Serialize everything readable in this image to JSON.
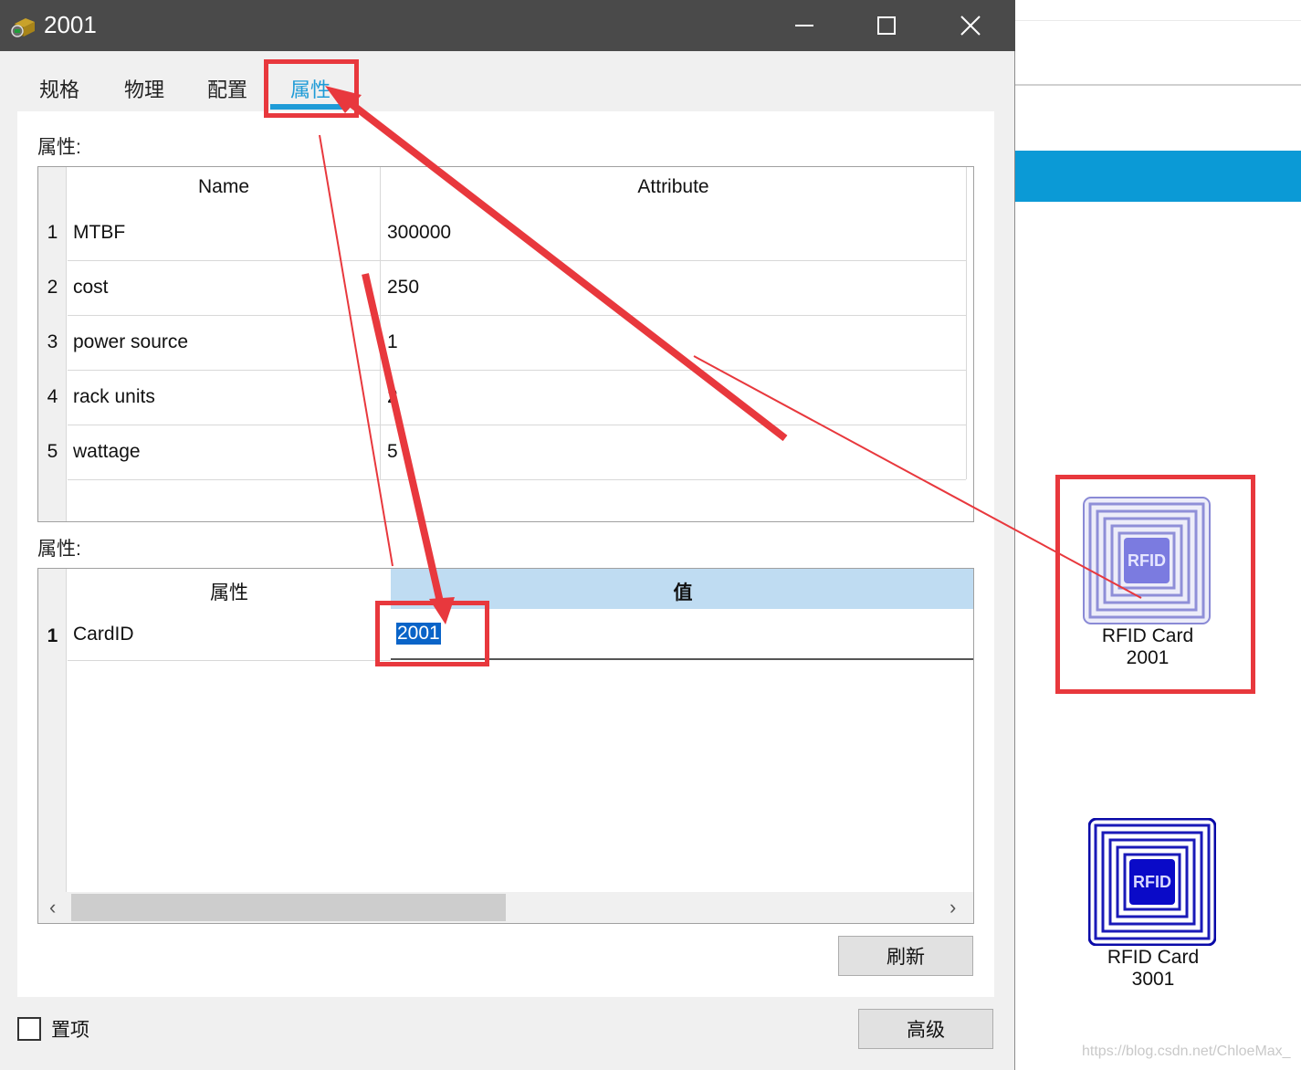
{
  "window": {
    "title": "2001"
  },
  "tabs": [
    {
      "label": "规格",
      "active": false
    },
    {
      "label": "物理",
      "active": false
    },
    {
      "label": "配置",
      "active": false
    },
    {
      "label": "属性",
      "active": true
    }
  ],
  "attributes_section": {
    "label": "属性:",
    "headers": {
      "name": "Name",
      "attribute": "Attribute"
    },
    "rows": [
      {
        "num": "1",
        "name": "MTBF",
        "value": "300000"
      },
      {
        "num": "2",
        "name": "cost",
        "value": "250"
      },
      {
        "num": "3",
        "name": "power source",
        "value": "1"
      },
      {
        "num": "4",
        "name": "rack units",
        "value": "2"
      },
      {
        "num": "5",
        "name": "wattage",
        "value": "5"
      }
    ]
  },
  "properties_section": {
    "label": "属性:",
    "headers": {
      "property": "属性",
      "value": "值"
    },
    "rows": [
      {
        "num": "1",
        "property": "CardID",
        "value": "2001"
      }
    ]
  },
  "buttons": {
    "refresh": "刷新",
    "advanced": "高级"
  },
  "pin_checkbox": {
    "label": "置项",
    "checked": false
  },
  "canvas": {
    "devices": [
      {
        "label_line1": "RFID Card",
        "label_line2": "2001",
        "highlighted": true
      },
      {
        "label_line1": "RFID Card",
        "label_line2": "3001",
        "highlighted": false
      }
    ],
    "rfid_chip_text": "RFID"
  },
  "watermark": "https://blog.csdn.net/ChloeMax_",
  "colors": {
    "accent": "#1e9bd7",
    "annotation": "#e8383d",
    "titlebar": "#4a4a4a",
    "selected_header": "#bfdcf2"
  }
}
